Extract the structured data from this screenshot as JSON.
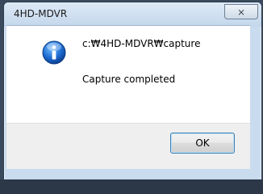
{
  "window": {
    "title": "4HD-MDVR",
    "close_symbol": "⨯"
  },
  "message": {
    "icon": "info-icon",
    "path": "c:₩4HD-MDVR₩capture",
    "text": "Capture completed"
  },
  "buttons": {
    "ok_label": "OK"
  }
}
